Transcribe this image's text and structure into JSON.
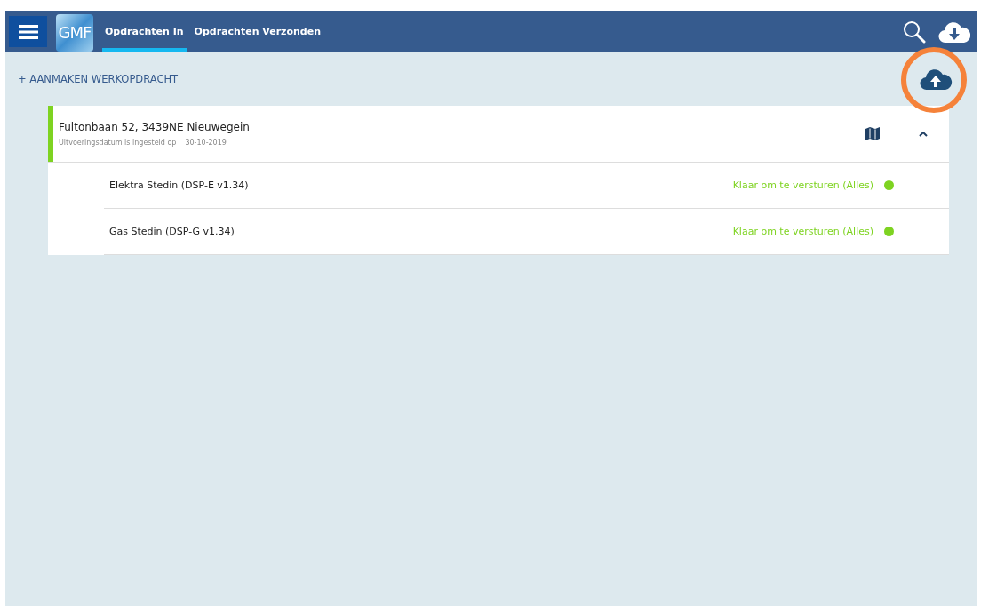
{
  "navbar": {
    "logo": "GMF",
    "tabs": [
      {
        "label": "Opdrachten In",
        "selected": true
      },
      {
        "label": "Opdrachten Verzonden",
        "selected": false
      }
    ]
  },
  "create_button": {
    "icon": "+",
    "label": "AANMAKEN WERKOPDRACHT"
  },
  "upload": {
    "highlighted": true
  },
  "groups": [
    {
      "address": "Fultonbaan 52, 3439NE Nieuwegein",
      "date_label": "Uitvoeringsdatum is ingesteld op",
      "date": "30-10-2019",
      "color": "#7ed321",
      "expanded": true,
      "items": [
        {
          "name": "Elektra Stedin (DSP-E v1.34)",
          "status": "Klaar om te versturen (Alles)",
          "color": "#7ed321"
        },
        {
          "name": "Gas Stedin (DSP-G v1.34)",
          "status": "Klaar om te versturen (Alles)",
          "color": "#7ed321"
        }
      ]
    }
  ]
}
